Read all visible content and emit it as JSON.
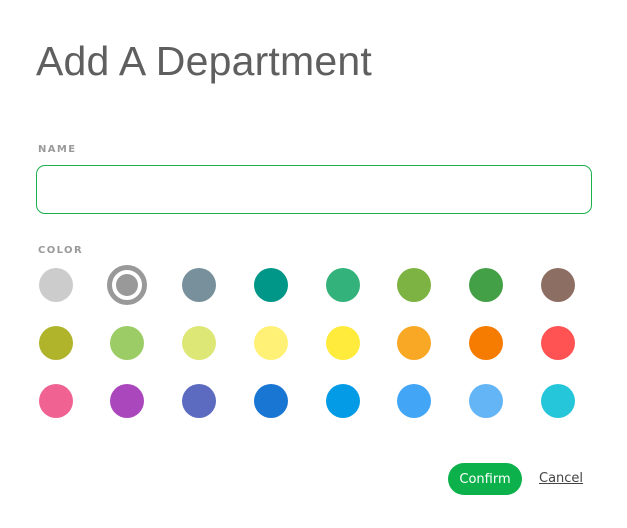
{
  "dialog": {
    "title": "Add A Department",
    "name_label": "NAME",
    "name_value": "",
    "name_placeholder": "",
    "color_label": "COLOR",
    "selected_color_index": 1,
    "colors": [
      "#cccccc",
      "#999999",
      "#78909c",
      "#009688",
      "#33b27b",
      "#7cb342",
      "#43a047",
      "#8d6e63",
      "#afb42b",
      "#9ccc65",
      "#dce775",
      "#fff176",
      "#ffeb3b",
      "#f9a825",
      "#f57c00",
      "#ff5252",
      "#f06292",
      "#ab47bc",
      "#5c6bc0",
      "#1976d2",
      "#039be5",
      "#42a5f5",
      "#64b5f6",
      "#26c6da"
    ],
    "confirm_label": "Confirm",
    "cancel_label": "Cancel",
    "accent_color": "#0db14b"
  }
}
